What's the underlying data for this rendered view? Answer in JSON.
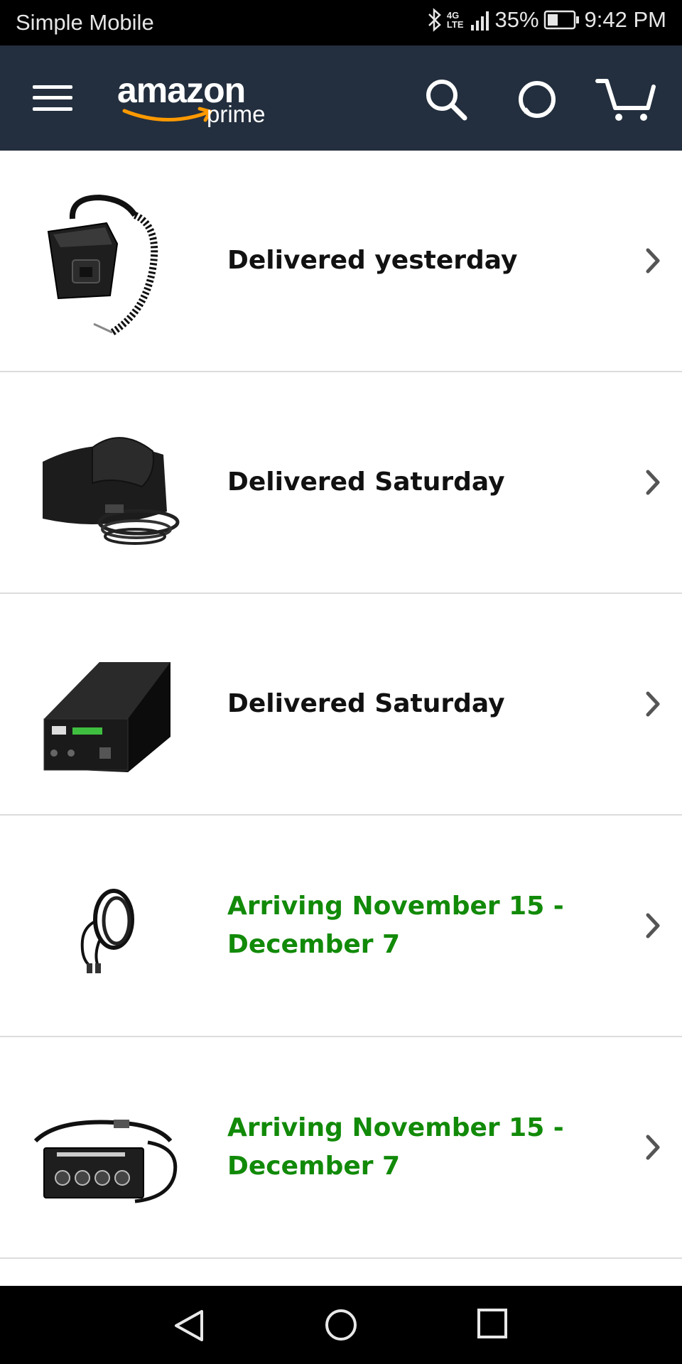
{
  "status_bar": {
    "carrier": "Simple Mobile",
    "network_type": "4G LTE",
    "battery": "35%",
    "time": "9:42 PM",
    "icons": [
      "bluetooth-icon",
      "signal-icon",
      "battery-icon"
    ]
  },
  "header": {
    "logo_word": "amazon",
    "logo_sub": "prime",
    "icons": [
      "menu-icon",
      "search-icon",
      "alexa-icon",
      "cart-icon"
    ],
    "bg_color": "#232f3e",
    "accent_color": "#ff9900"
  },
  "orders": [
    {
      "status": "Delivered yesterday",
      "state": "delivered",
      "product_image": "coiled-cable-controller"
    },
    {
      "status": "Delivered Saturday",
      "state": "delivered",
      "product_image": "black-strap-with-cable"
    },
    {
      "status": "Delivered Saturday",
      "state": "delivered",
      "product_image": "black-power-tank"
    },
    {
      "status": "Arriving November 15 - December 7",
      "state": "arriving",
      "product_image": "coiled-black-cord"
    },
    {
      "status": "Arriving November 15 - December 7",
      "state": "arriving",
      "product_image": "dew-heater-controller"
    }
  ],
  "colors": {
    "arriving": "#128a09",
    "delivered": "#111111"
  },
  "nav_bar": {
    "icons": [
      "back-icon",
      "home-icon",
      "recents-icon"
    ]
  }
}
